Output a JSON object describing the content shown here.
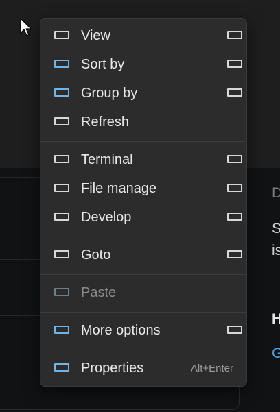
{
  "menu": {
    "items": [
      {
        "label": "View",
        "icon": "view-icon",
        "submenu": true
      },
      {
        "label": "Sort by",
        "icon": "sort-icon",
        "submenu": true
      },
      {
        "label": "Group by",
        "icon": "group-icon",
        "submenu": true
      },
      {
        "label": "Refresh",
        "icon": "refresh-icon",
        "submenu": false
      },
      {
        "label": "Terminal",
        "icon": "terminal-icon",
        "submenu": true
      },
      {
        "label": "File manage",
        "icon": "file-manage-icon",
        "submenu": true
      },
      {
        "label": "Develop",
        "icon": "develop-icon",
        "submenu": true
      },
      {
        "label": "Goto",
        "icon": "goto-icon",
        "submenu": true
      },
      {
        "label": "Paste",
        "icon": "paste-icon",
        "submenu": false,
        "disabled": true
      },
      {
        "label": "More options",
        "icon": "more-options-icon",
        "submenu": true
      },
      {
        "label": "Properties",
        "icon": "properties-icon",
        "submenu": false,
        "shortcut": "Alt+Enter"
      }
    ]
  },
  "background": {
    "right_pane_letters": [
      "D",
      "S",
      "is",
      "H",
      "G"
    ]
  },
  "colors": {
    "menu_bg": "#2c2c2c",
    "icon_accent": "#6fb6e8",
    "text": "#e8e8e8",
    "shortcut_text": "#9a9a9a"
  }
}
